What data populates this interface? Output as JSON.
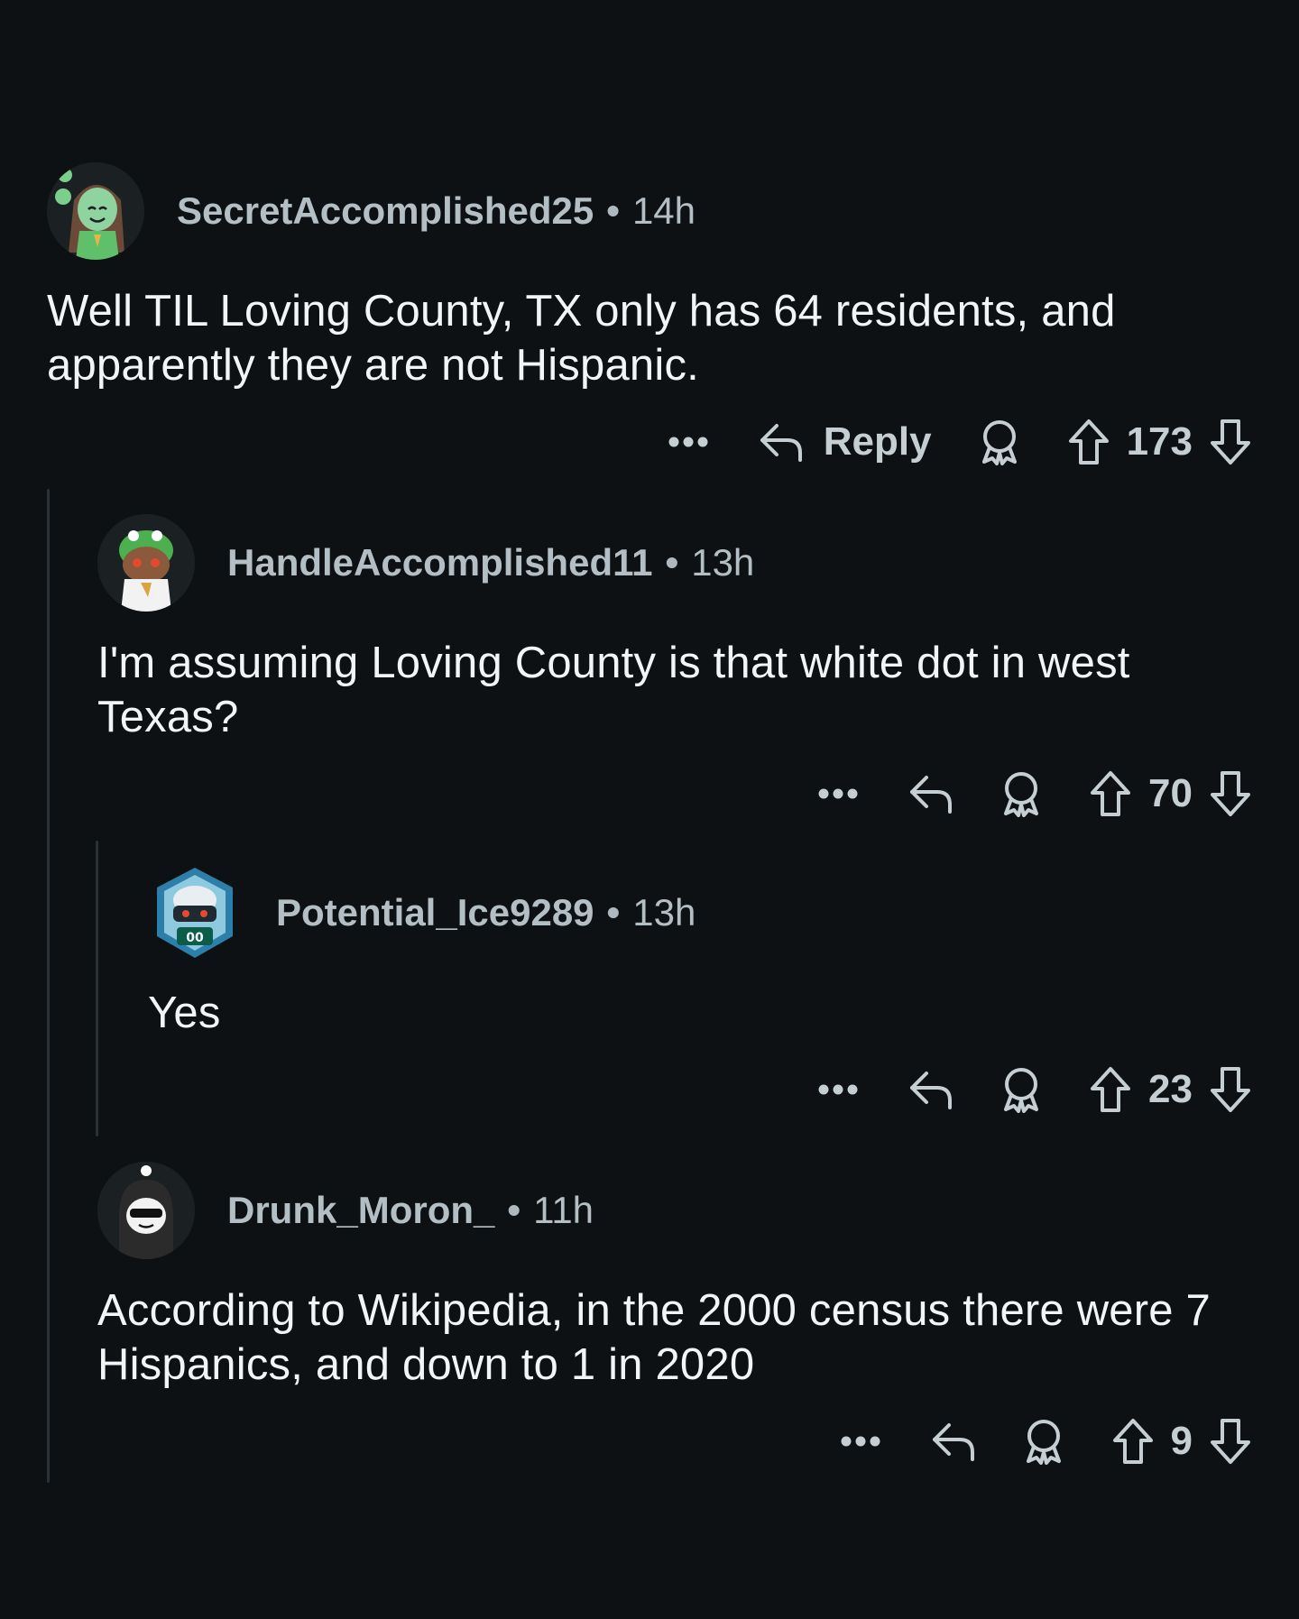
{
  "comments": [
    {
      "username": "SecretAccomplished25",
      "time": "14h",
      "text": "Well TIL Loving County, TX only has 64 residents, and apparently they are not Hispanic.",
      "reply_label": "Reply",
      "score": "173"
    },
    {
      "username": "HandleAccomplished11",
      "time": "13h",
      "text": "I'm assuming Loving County is that white dot in west Texas?",
      "score": "70"
    },
    {
      "username": "Potential_Ice9289",
      "time": "13h",
      "text": "Yes",
      "score": "23"
    },
    {
      "username": "Drunk_Moron_",
      "time": "11h",
      "text": "According to Wikipedia, in the 2000 census there were 7 Hispanics, and down to 1 in 2020",
      "score": "9"
    }
  ],
  "separator": "•",
  "icons": {
    "more": "more-icon",
    "reply": "reply-icon",
    "award": "award-icon",
    "upvote": "upvote-icon",
    "downvote": "downvote-icon"
  },
  "colors": {
    "background": "#0e1113",
    "text": "#f2f4f5",
    "meta": "#b3bfc5",
    "thread_line": "#2a3236"
  }
}
